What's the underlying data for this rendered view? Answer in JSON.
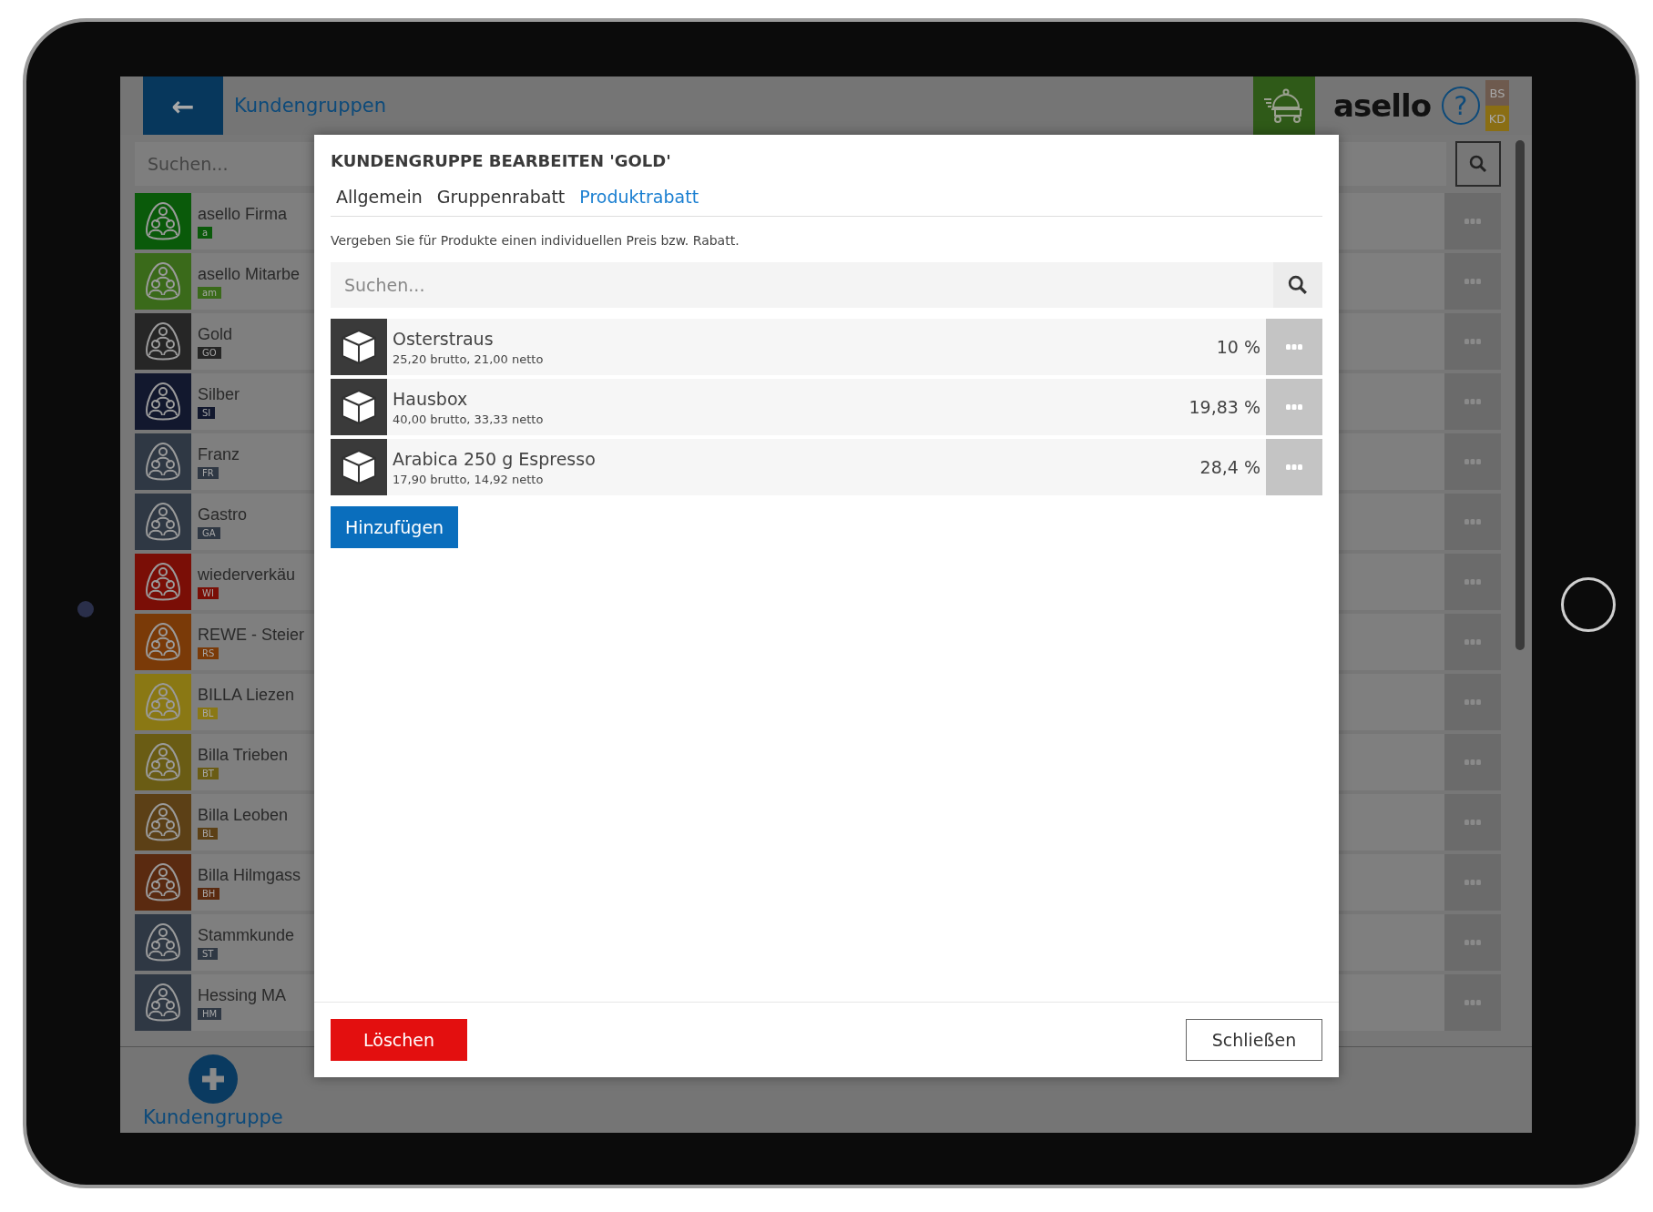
{
  "header": {
    "back_label": "←",
    "title": "Kundengruppen",
    "logo": "asello",
    "help": "?",
    "badges": [
      {
        "text": "BS",
        "color": "#6e5a4e"
      },
      {
        "text": "KD",
        "color": "#8a6e14"
      }
    ]
  },
  "list_search": {
    "placeholder": "Suchen..."
  },
  "groups": [
    {
      "name": "asello Firma",
      "code": "a",
      "color": "#0a5a0a"
    },
    {
      "name": "asello Mitarbe",
      "code": "am",
      "color": "#3a6a1a"
    },
    {
      "name": "Gold",
      "code": "GO",
      "color": "#262626"
    },
    {
      "name": "Silber",
      "code": "SI",
      "color": "#12182e"
    },
    {
      "name": "Franz",
      "code": "FR",
      "color": "#2f3844"
    },
    {
      "name": "Gastro",
      "code": "GA",
      "color": "#2f3844"
    },
    {
      "name": "wiederverkäu",
      "code": "WI",
      "color": "#7a0e06"
    },
    {
      "name": "REWE - Steier",
      "code": "RS",
      "color": "#7a3a08"
    },
    {
      "name": "BILLA Liezen",
      "code": "BL",
      "color": "#8a7814"
    },
    {
      "name": "Billa Trieben",
      "code": "BT",
      "color": "#6a5c14"
    },
    {
      "name": "Billa Leoben",
      "code": "BL",
      "color": "#5c4016"
    },
    {
      "name": "Billa Hilmgass",
      "code": "BH",
      "color": "#5a2a10"
    },
    {
      "name": "Stammkunde",
      "code": "ST",
      "color": "#2f3844"
    },
    {
      "name": "Hessing MA",
      "code": "HM",
      "color": "#2f3844"
    }
  ],
  "add_button": {
    "label": "Kundengruppe"
  },
  "dialog": {
    "title": "KUNDENGRUPPE BEARBEITEN 'GOLD'",
    "tabs": [
      {
        "label": "Allgemein",
        "selected": false
      },
      {
        "label": "Gruppenrabatt",
        "selected": false
      },
      {
        "label": "Produktrabatt",
        "selected": true
      }
    ],
    "description": "Vergeben Sie für Produkte einen individuellen Preis bzw. Rabatt.",
    "search": {
      "placeholder": "Suchen..."
    },
    "products": [
      {
        "name": "Osterstraus",
        "prices": "25,20 brutto, 21,00 netto",
        "discount": "10 %"
      },
      {
        "name": "Hausbox",
        "prices": "40,00 brutto, 33,33 netto",
        "discount": "19,83 %"
      },
      {
        "name": "Arabica 250 g Espresso",
        "prices": "17,90 brutto, 14,92 netto",
        "discount": "28,4 %"
      }
    ],
    "add_label": "Hinzufügen",
    "delete_label": "Löschen",
    "close_label": "Schließen"
  }
}
